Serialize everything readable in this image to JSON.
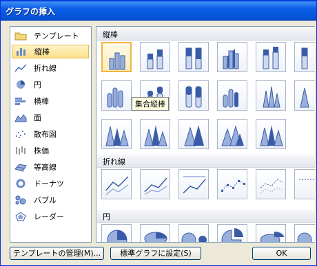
{
  "window": {
    "title": "グラフの挿入"
  },
  "sidebar": {
    "items": [
      {
        "label": "テンプレート",
        "icon": "folder-icon"
      },
      {
        "label": "縦棒",
        "icon": "column-chart-icon",
        "selected": true
      },
      {
        "label": "折れ線",
        "icon": "line-chart-icon"
      },
      {
        "label": "円",
        "icon": "pie-chart-icon"
      },
      {
        "label": "横棒",
        "icon": "bar-chart-icon"
      },
      {
        "label": "面",
        "icon": "area-chart-icon"
      },
      {
        "label": "散布図",
        "icon": "scatter-chart-icon"
      },
      {
        "label": "株価",
        "icon": "stock-chart-icon"
      },
      {
        "label": "等高線",
        "icon": "surface-chart-icon"
      },
      {
        "label": "ドーナツ",
        "icon": "doughnut-chart-icon"
      },
      {
        "label": "バブル",
        "icon": "bubble-chart-icon"
      },
      {
        "label": "レーダー",
        "icon": "radar-chart-icon"
      }
    ]
  },
  "gallery": {
    "sections": [
      {
        "title": "縦棒"
      },
      {
        "title": "折れ線"
      },
      {
        "title": "円"
      }
    ],
    "tooltip": "集合縦棒"
  },
  "buttons": {
    "manage_templates": "テンプレートの管理(M)...",
    "set_default": "標準グラフに設定(S)",
    "ok": "OK"
  }
}
